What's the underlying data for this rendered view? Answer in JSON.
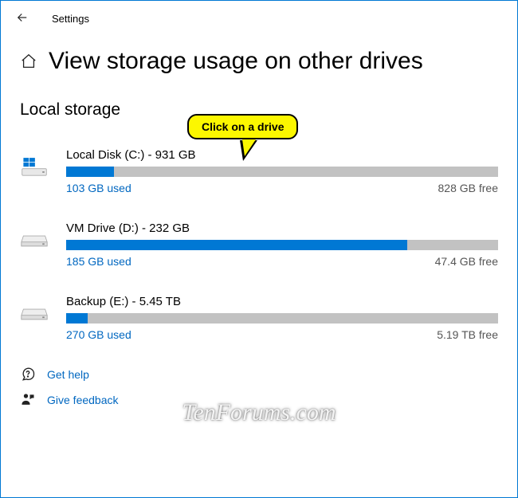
{
  "app": {
    "title": "Settings"
  },
  "page": {
    "title": "View storage usage on other drives",
    "section": "Local storage"
  },
  "callout": {
    "text": "Click on a drive"
  },
  "drives": [
    {
      "label": "Local Disk (C:) - 931 GB",
      "used": "103 GB used",
      "free": "828 GB free",
      "fill_pct": 11,
      "os": true
    },
    {
      "label": "VM Drive (D:) - 232 GB",
      "used": "185 GB used",
      "free": "47.4 GB free",
      "fill_pct": 79,
      "os": false
    },
    {
      "label": "Backup (E:) - 5.45 TB",
      "used": "270 GB used",
      "free": "5.19 TB free",
      "fill_pct": 5,
      "os": false
    }
  ],
  "links": {
    "help": "Get help",
    "feedback": "Give feedback"
  },
  "watermark": "TenForums.com"
}
